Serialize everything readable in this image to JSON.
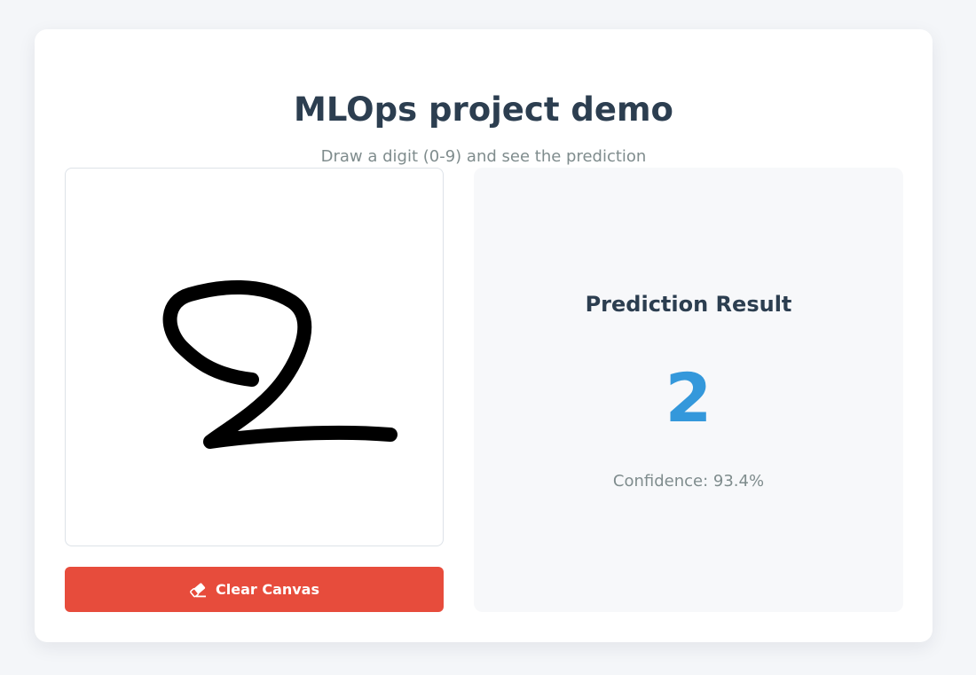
{
  "header": {
    "title": "MLOps project demo",
    "subtitle": "Draw a digit (0-9) and see the prediction"
  },
  "canvas": {
    "drawn_digit": "2"
  },
  "clear_button": {
    "label": "Clear Canvas",
    "icon": "eraser-icon"
  },
  "result": {
    "title": "Prediction Result",
    "digit": "2",
    "confidence_label": "Confidence: 93.4%"
  },
  "colors": {
    "accent": "#3498db",
    "danger": "#e74c3c",
    "heading": "#2c3e50",
    "muted": "#7f8c8d"
  }
}
